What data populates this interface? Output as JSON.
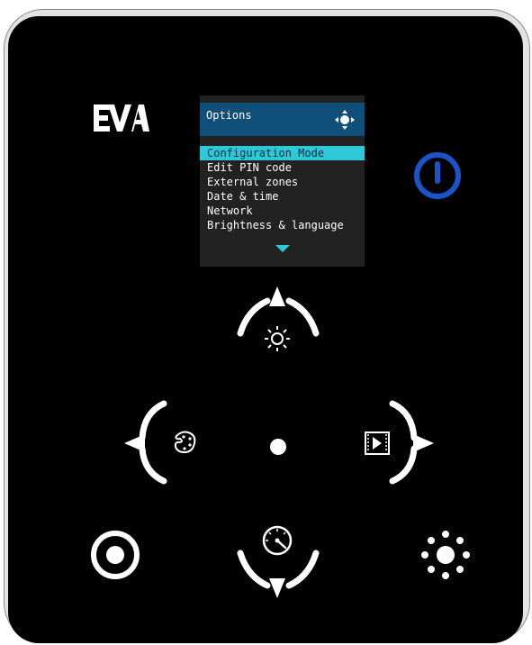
{
  "device": {
    "brand_logo": "EVA",
    "power_button": {
      "icon": "power-icon",
      "color": "#1a54c8"
    }
  },
  "screen": {
    "title": "Options",
    "nav_icon": "four-way-navigation-icon",
    "header_color": "#0f4f7a",
    "selected_color": "#2ec8d8",
    "menu": [
      {
        "label": "Configuration Mode",
        "selected": true
      },
      {
        "label": "Edit PIN code",
        "selected": false
      },
      {
        "label": "External zones",
        "selected": false
      },
      {
        "label": "Date & time",
        "selected": false
      },
      {
        "label": "Network",
        "selected": false
      },
      {
        "label": "Brightness & language",
        "selected": false
      }
    ],
    "more_indicator": "scroll-down-arrow-icon"
  },
  "controls": {
    "up": "brightness-icon",
    "left": "color-palette-icon",
    "center": "center-dot-icon",
    "right": "media-play-icon",
    "down": "speed-gauge-icon",
    "bottom_left": "target-ring-icon",
    "bottom_right": "sparkle-dots-icon"
  }
}
